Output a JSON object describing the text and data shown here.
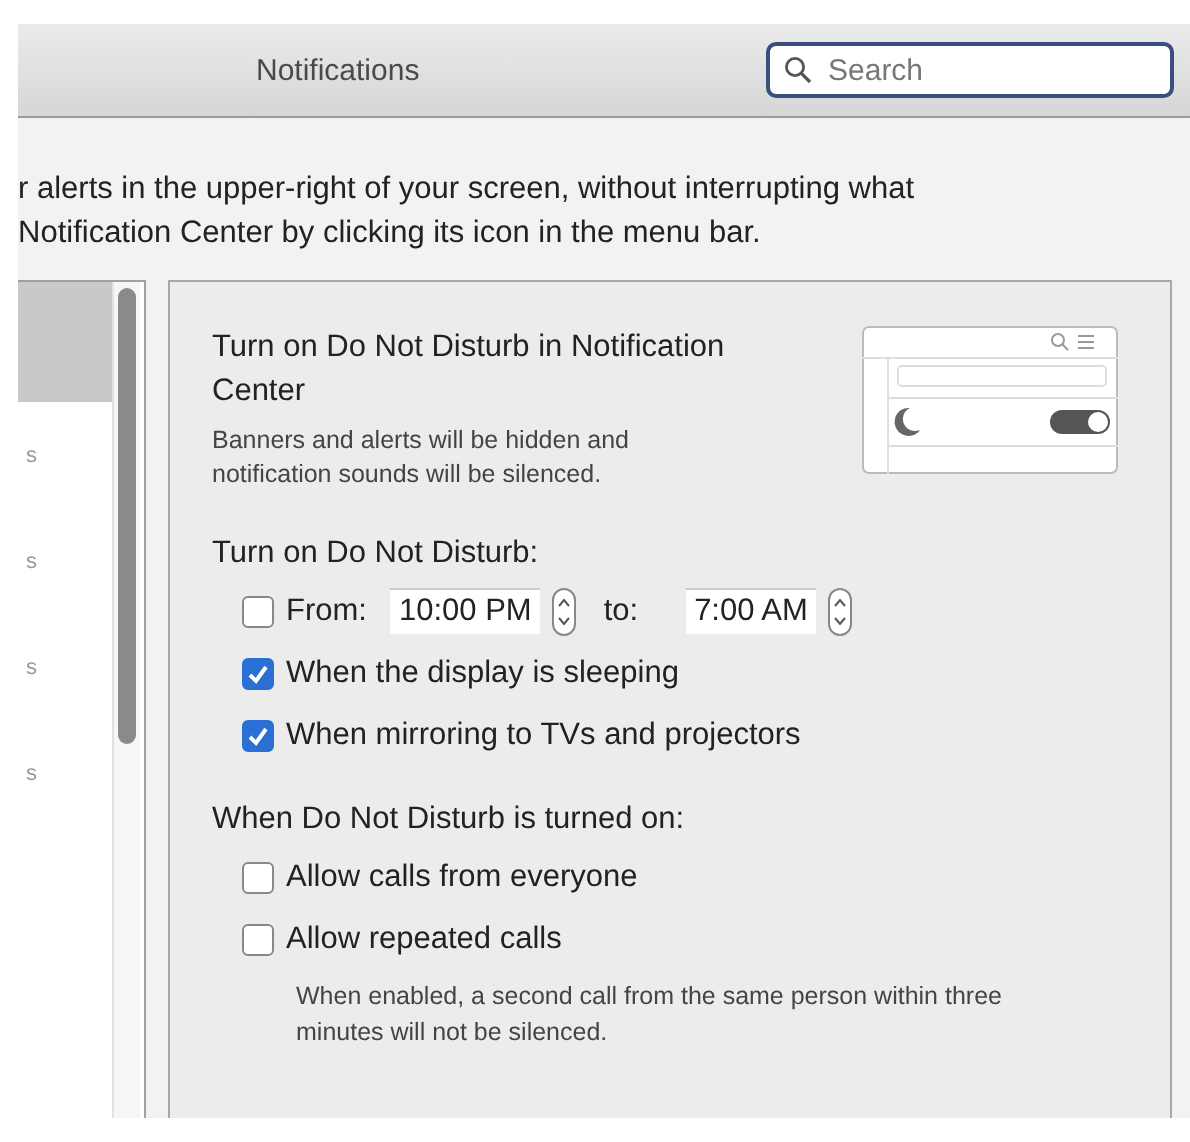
{
  "window": {
    "title": "Notifications"
  },
  "search": {
    "placeholder": "Search"
  },
  "description": [
    "r alerts in the upper-right of your screen, without interrupting what",
    "Notification Center by clicking its icon in the menu bar."
  ],
  "sidebar": {
    "items": [
      {
        "selected": true
      },
      {
        "label": "s",
        "selected": false
      },
      {
        "label": "s",
        "selected": false
      },
      {
        "label": "s",
        "selected": false
      },
      {
        "label": "s",
        "selected": false
      }
    ]
  },
  "panel": {
    "heading": "Turn on Do Not Disturb in Notification Center",
    "note": "Banners and alerts will be hidden and notification sounds will be silenced.",
    "sections": [
      {
        "heading": "Turn on Do Not Disturb:",
        "options": [
          {
            "kind": "time_range",
            "checked": false,
            "label": "From:",
            "from": "10:00 PM",
            "to_label": "to:",
            "to": "7:00 AM"
          },
          {
            "kind": "checkbox",
            "checked": true,
            "label": "When the display is sleeping"
          },
          {
            "kind": "checkbox",
            "checked": true,
            "label": "When mirroring to TVs and projectors"
          }
        ]
      },
      {
        "heading": "When Do Not Disturb is turned on:",
        "options": [
          {
            "kind": "checkbox",
            "checked": false,
            "label": "Allow calls from everyone"
          },
          {
            "kind": "checkbox",
            "checked": false,
            "label": "Allow repeated calls",
            "note": "When enabled, a second call from the same person within three minutes will not be silenced."
          }
        ]
      }
    ]
  }
}
